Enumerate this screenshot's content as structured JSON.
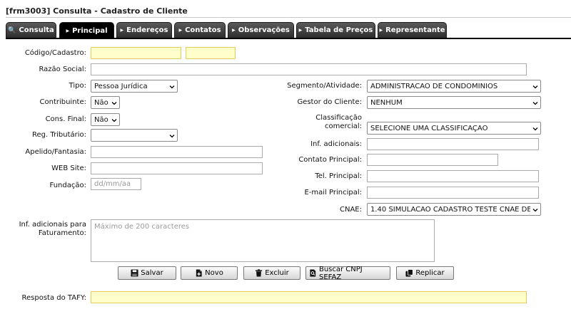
{
  "title": "[frm3003] Consulta - Cadastro de Cliente",
  "tabs": [
    {
      "label": "Consulta"
    },
    {
      "label": "Principal"
    },
    {
      "label": "Endereços"
    },
    {
      "label": "Contatos"
    },
    {
      "label": "Observações"
    },
    {
      "label": "Tabela de Preços"
    },
    {
      "label": "Representante"
    }
  ],
  "active_tab": "Principal",
  "form": {
    "codigo_label": "Código/Cadastro:",
    "codigo_value": "",
    "cadastro_value": "",
    "razao_label": "Razão Social:",
    "razao_value": "",
    "tipo_label": "Tipo:",
    "tipo_value": "Pessoa Jurídica",
    "contribuinte_label": "Contribuinte:",
    "contribuinte_value": "Não",
    "consfinal_label": "Cons. Final:",
    "consfinal_value": "Não",
    "regtrib_label": "Reg. Tributário:",
    "regtrib_value": "",
    "apelido_label": "Apelido/Fantasia:",
    "apelido_value": "",
    "web_label": "WEB Site:",
    "web_value": "",
    "fundacao_label": "Fundação:",
    "fundacao_placeholder": "dd/mm/aa",
    "segmento_label": "Segmento/Atividade:",
    "segmento_value": "ADMINISTRACAO DE CONDOMINIOS",
    "gestor_label": "Gestor do Cliente:",
    "gestor_value": "NENHUM",
    "classif_label_1": "Classificação",
    "classif_label_2": "comercial:",
    "classif_value": "SELECIONE UMA CLASSIFICAÇÃO",
    "infadic_label": "Inf. adicionais:",
    "infadic_value": "",
    "contato_label": "Contato Principal:",
    "contato_value": "",
    "tel_label": "Tel. Principal:",
    "tel_value": "",
    "email_label": "E-mail Principal:",
    "email_value": "",
    "cnae_label": "CNAE:",
    "cnae_value": "1.40 SIMULACAO CADASTRO TESTE CNAE DE C",
    "fat_label_1": "Inf. adicionais para",
    "fat_label_2": "Faturamento:",
    "fat_placeholder": "Máximo de 200 caracteres",
    "tafy_label": "Resposta do TAFY:",
    "tafy_value": ""
  },
  "buttons": {
    "salvar": "Salvar",
    "novo": "Novo",
    "excluir": "Excluir",
    "buscar": "Buscar CNPJ SEFAZ",
    "replicar": "Replicar"
  },
  "icons": {
    "search": "magnifier-icon",
    "tab_arrow": "triangle-right-icon",
    "caret": "chevron-down-icon",
    "salvar": "floppy-disk-icon",
    "novo": "new-document-icon",
    "excluir": "trash-icon",
    "buscar": "search-document-icon",
    "replicar": "copy-icon"
  },
  "colors": {
    "required_field": "#ffffcc",
    "tab_bg": "#3a3a3a",
    "tab_active_bg": "#000000"
  }
}
